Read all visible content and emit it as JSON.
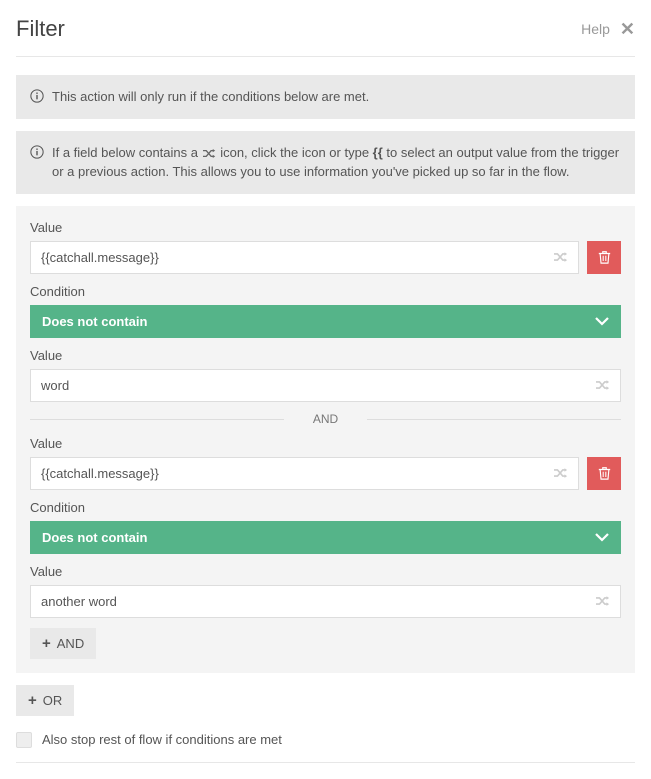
{
  "header": {
    "title": "Filter",
    "help_label": "Help"
  },
  "info": {
    "msg1": "This action will only run if the conditions below are met.",
    "msg2a": "If a field below contains a ",
    "msg2b": " icon, click the icon or type ",
    "msg2c": "{{",
    "msg2d": " to select an output value from the trigger or a previous action. This allows you to use information you've picked up so far in the flow."
  },
  "labels": {
    "value": "Value",
    "condition": "Condition",
    "and_sep": "AND",
    "and_btn": "AND",
    "or_btn": "OR",
    "checkbox": "Also stop rest of flow if conditions are met"
  },
  "conditions": [
    {
      "value_input": "{{catchall.message}}",
      "operator": "Does not contain",
      "compare_value": "word"
    },
    {
      "value_input": "{{catchall.message}}",
      "operator": "Does not contain",
      "compare_value": "another word"
    }
  ]
}
